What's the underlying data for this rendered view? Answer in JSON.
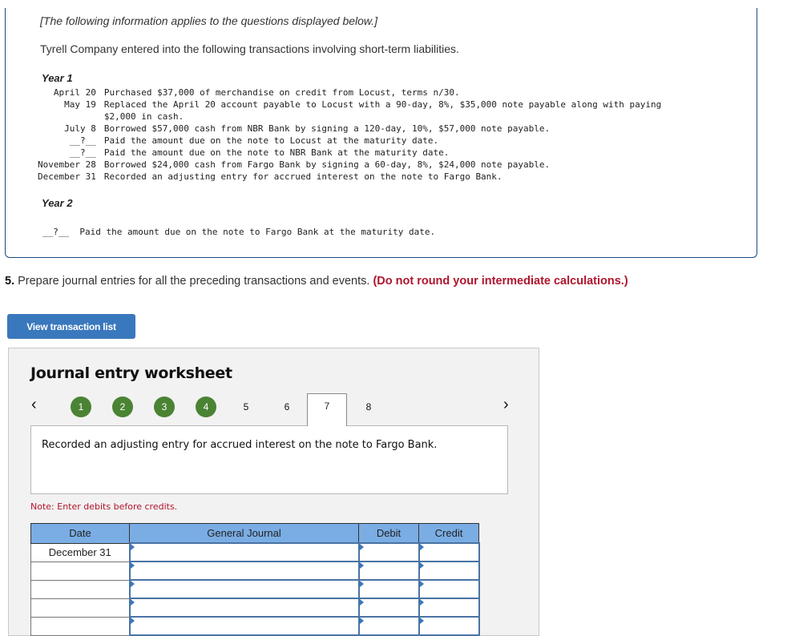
{
  "info": {
    "intro": "[The following information applies to the questions displayed below.]",
    "description": "Tyrell Company entered into the following transactions involving short-term liabilities.",
    "year1_label": "Year 1",
    "year1_transactions": [
      {
        "date": "April 20",
        "text": "Purchased $37,000 of merchandise on credit from Locust, terms n/30."
      },
      {
        "date": "May 19",
        "text": "Replaced the April 20 account payable to Locust with a 90-day, 8%, $35,000 note payable along with paying"
      },
      {
        "date": "",
        "text": "$2,000 in cash."
      },
      {
        "date": "July 8",
        "text": "Borrowed $57,000 cash from NBR Bank by signing a 120-day, 10%, $57,000 note payable."
      },
      {
        "date": "__?__",
        "text": "Paid the amount due on the note to Locust at the maturity date."
      },
      {
        "date": "__?__",
        "text": "Paid the amount due on the note to NBR Bank at the maturity date."
      },
      {
        "date": "November 28",
        "text": "Borrowed $24,000 cash from Fargo Bank by signing a 60-day, 8%, $24,000 note payable."
      },
      {
        "date": "December 31",
        "text": "Recorded an adjusting entry for accrued interest on the note to Fargo Bank."
      }
    ],
    "year2_label": "Year 2",
    "year2_transaction": "__?__  Paid the amount due on the note to Fargo Bank at the maturity date."
  },
  "question": {
    "number": "5.",
    "text": " Prepare journal entries for all the preceding transactions and events. ",
    "warning": "(Do not round your intermediate calculations.)"
  },
  "view_button_label": "View transaction list",
  "worksheet": {
    "title": "Journal entry worksheet",
    "prev_icon": "‹",
    "next_icon": "›",
    "steps": [
      {
        "label": "1",
        "state": "done"
      },
      {
        "label": "2",
        "state": "done"
      },
      {
        "label": "3",
        "state": "done"
      },
      {
        "label": "4",
        "state": "done"
      },
      {
        "label": "5",
        "state": "plain"
      },
      {
        "label": "6",
        "state": "plain"
      },
      {
        "label": "7",
        "state": "active"
      },
      {
        "label": "8",
        "state": "plain"
      }
    ],
    "description": "Recorded an adjusting entry for accrued interest on the note to Fargo Bank.",
    "note": "Note: Enter debits before credits.",
    "table": {
      "headers": [
        "Date",
        "General Journal",
        "Debit",
        "Credit"
      ],
      "rows": [
        {
          "date": "December 31",
          "account": "",
          "debit": "",
          "credit": ""
        },
        {
          "date": "",
          "account": "",
          "debit": "",
          "credit": ""
        },
        {
          "date": "",
          "account": "",
          "debit": "",
          "credit": ""
        },
        {
          "date": "",
          "account": "",
          "debit": "",
          "credit": ""
        },
        {
          "date": "",
          "account": "",
          "debit": "",
          "credit": ""
        }
      ]
    }
  },
  "colors": {
    "accent_blue": "#3a78bd",
    "header_blue": "#7aade4",
    "done_green": "#4a8334",
    "warning_red": "#b0152d",
    "frame_navy": "#1c4a80"
  }
}
